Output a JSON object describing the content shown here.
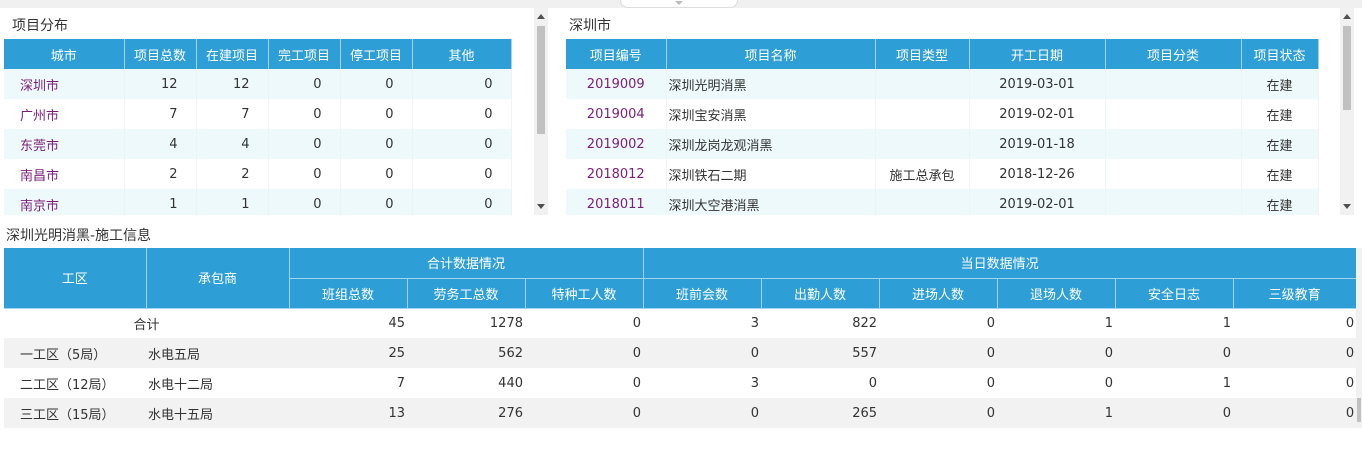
{
  "distribution": {
    "title": "项目分布",
    "columns": [
      "城市",
      "项目总数",
      "在建项目",
      "完工项目",
      "停工项目",
      "其他"
    ],
    "rows": [
      [
        "深圳市",
        "12",
        "12",
        "0",
        "0",
        "0"
      ],
      [
        "广州市",
        "7",
        "7",
        "0",
        "0",
        "0"
      ],
      [
        "东莞市",
        "4",
        "4",
        "0",
        "0",
        "0"
      ],
      [
        "南昌市",
        "2",
        "2",
        "0",
        "0",
        "0"
      ],
      [
        "南京市",
        "1",
        "1",
        "0",
        "0",
        "0"
      ]
    ]
  },
  "city_projects": {
    "title": "深圳市",
    "columns": [
      "项目编号",
      "项目名称",
      "项目类型",
      "开工日期",
      "项目分类",
      "项目状态"
    ],
    "rows": [
      [
        "2019009",
        "深圳光明消黑",
        "",
        "2019-03-01",
        "",
        "在建"
      ],
      [
        "2019004",
        "深圳宝安消黑",
        "",
        "2019-02-01",
        "",
        "在建"
      ],
      [
        "2019002",
        "深圳龙岗龙观消黑",
        "",
        "2019-01-18",
        "",
        "在建"
      ],
      [
        "2018012",
        "深圳铁石二期",
        "施工总承包",
        "2018-12-26",
        "",
        "在建"
      ],
      [
        "2018011",
        "深圳大空港消黑",
        "",
        "2019-02-01",
        "",
        "在建"
      ]
    ]
  },
  "construction": {
    "title": "深圳光明消黑-施工信息",
    "header_zone": "工区",
    "header_contractor": "承包商",
    "group_total": "合计数据情况",
    "group_today": "当日数据情况",
    "subcolumns": [
      "班组总数",
      "劳务工总数",
      "特种工人数",
      "班前会数",
      "出勤人数",
      "进场人数",
      "退场人数",
      "安全日志",
      "三级教育"
    ],
    "total_label": "合计",
    "total_values": [
      "45",
      "1278",
      "0",
      "3",
      "822",
      "0",
      "1",
      "1",
      "0"
    ],
    "rows": [
      {
        "zone": "一工区（5局）",
        "contractor": "水电五局",
        "values": [
          "25",
          "562",
          "0",
          "0",
          "557",
          "0",
          "0",
          "0",
          "0"
        ]
      },
      {
        "zone": "二工区（12局）",
        "contractor": "水电十二局",
        "values": [
          "7",
          "440",
          "0",
          "3",
          "0",
          "0",
          "0",
          "1",
          "0"
        ]
      },
      {
        "zone": "三工区（15局）",
        "contractor": "水电十五局",
        "values": [
          "13",
          "276",
          "0",
          "0",
          "265",
          "0",
          "1",
          "0",
          "0"
        ]
      }
    ]
  },
  "icons": {
    "scroll_up": "chevron-up-icon",
    "scroll_down": "chevron-down-icon",
    "collapse_tab": "chevron-down-icon"
  },
  "colors": {
    "header_bg": "#2e9fd6",
    "link_text": "#7a1e78",
    "row_alt": "#eef9fb",
    "row_grey": "#f2f2f2"
  }
}
